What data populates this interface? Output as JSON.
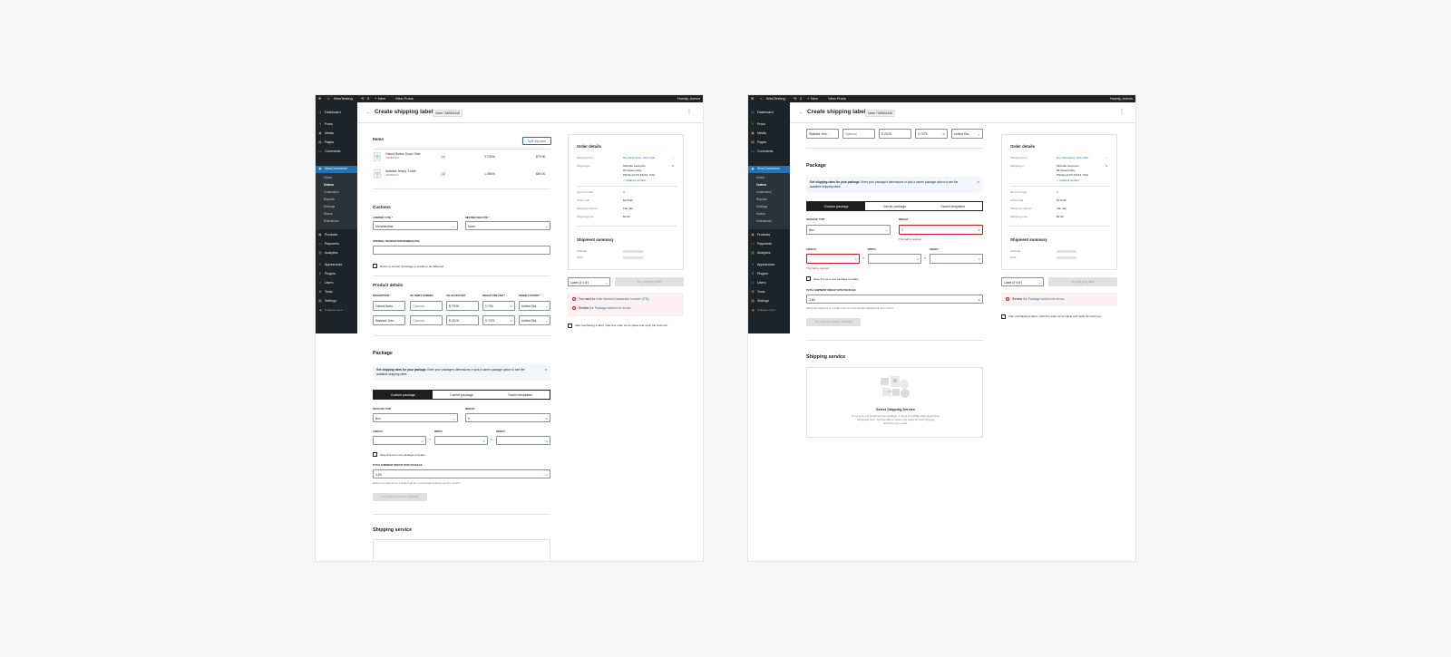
{
  "admin_bar": {
    "site": "WooTesting",
    "comments_count": "0",
    "new": "New",
    "view_posts": "View Posts",
    "howdy": "Howdy, Admin"
  },
  "sidebar": {
    "items": [
      "Dashboard",
      "Posts",
      "Media",
      "Pages",
      "Comments",
      "WooCommerce",
      "Products",
      "Payments",
      "Analytics",
      "Appearance",
      "Plugins",
      "Users",
      "Tools",
      "Settings",
      "Collapse menu"
    ],
    "woo_sub": [
      "Home",
      "Orders",
      "Customers",
      "Reports",
      "Settings",
      "Status",
      "Extensions"
    ]
  },
  "header": {
    "title": "Create shipping label",
    "order_badge": "Order 7349802448"
  },
  "items": {
    "title": "Items",
    "split_button": "Split shipment",
    "rows": [
      {
        "name": "Oxford Button Down Shirt",
        "sku": "7349802448",
        "qty": "×1",
        "weight": "0.739 lb",
        "price": "$79.90"
      },
      {
        "name": "Washed Jersey T-shirt",
        "sku": "2602983249",
        "qty": "×2",
        "weight": "1.495 lb",
        "price": "$50.00"
      }
    ]
  },
  "customs": {
    "title": "Customs",
    "content_type_label": "CONTENT TYPE *",
    "content_type_value": "Merchandise",
    "restriction_label": "RESTRICTION TYPE *",
    "restriction_value": "None",
    "itn_label": "INTERNAL TRANSACTION NUMBER (ITN)",
    "return_label": "Return to sender if package is unable to be delivered"
  },
  "product_details": {
    "title": "Product details",
    "headers": [
      "DESCRIPTION *",
      "HS TARIFF NUMBER",
      "VALUE PER UNIT",
      "WEIGHT PER UNIT *",
      "ORIGIN COUNTRY *"
    ],
    "rows": [
      {
        "description": "Oxford Butto...",
        "hs": "Optional",
        "value": "$ 79.90",
        "weight": "0.739",
        "country": "United Sta..."
      },
      {
        "description": "Washed Jers...",
        "hs": "Optional",
        "value": "$ 25.00",
        "weight": "0.7475",
        "country": "United Sta..."
      }
    ],
    "unit": "lb"
  },
  "package": {
    "title": "Package",
    "notice_bold": "Get shipping rates for your package.",
    "notice_text": "Enter your package's dimensions or pick a carrier package option to see the available shipping rates.",
    "tabs": [
      "Custom package",
      "Carrier package",
      "Saved templates"
    ],
    "type_label": "PACKAGE TYPE",
    "type_value": "Box",
    "weight_label": "WEIGHT",
    "weight_value": "0",
    "length_label": "LENGTH",
    "width_label": "WIDTH",
    "height_label": "HEIGHT",
    "unit": "lb",
    "dim_unit": "in",
    "times": "×",
    "save_template": "Save this as a new package template",
    "total_label": "TOTAL SHIPMENT WEIGHT WITH PACKAGE",
    "total_value": "3.60",
    "total_help": "Weigh your shipment on a scale to get the most accurate shipping rate from carriers.",
    "get_rates": "Get rates for custom package",
    "required_error": "This field is required"
  },
  "shipping_service": {
    "title": "Shipping service",
    "empty_title": "Select Shipping Service",
    "empty_text_1": "As soon as you've defined your package, a range of suitable shipping services",
    "empty_text_2": "will appear here. You'll be able to review and select the best shipping",
    "empty_text_3": "option for your needs."
  },
  "order_details": {
    "title": "Order details",
    "ship_from_label": "Shipping from",
    "ship_from_value": "Roy McAndrew, 120 Collin...",
    "ship_to_label": "Shipping to",
    "ship_to_lines": [
      "Michelle Lawrence",
      "90 Galena Way",
      "Pittsburgh PA 15213, USA"
    ],
    "verified": "Address verified",
    "rows": [
      {
        "label": "Items in order",
        "value": "3"
      },
      {
        "label": "Order total",
        "value": "$179.90"
      },
      {
        "label": "Shipping method",
        "value": "Flat rate"
      },
      {
        "label": "Shipping price",
        "value": "$4.99"
      }
    ],
    "summary_title": "Shipment summary",
    "subtotal": "Subtotal",
    "total": "Total"
  },
  "actions": {
    "label_size": "Label (4\"x 6\")",
    "buy": "Buy shipping label",
    "err1_pre": "You need to",
    "err1_link": "enter internal transaction number (ITN).",
    "err2_pre": "Review",
    "err2_link": "the Package section for errors.",
    "complete": "After purchasing a label, mark this order as complete and notify the customer."
  },
  "colors": {
    "accent": "#2271b1",
    "error": "#cc1818",
    "success": "#008a20",
    "admin_dark": "#1d2327"
  }
}
